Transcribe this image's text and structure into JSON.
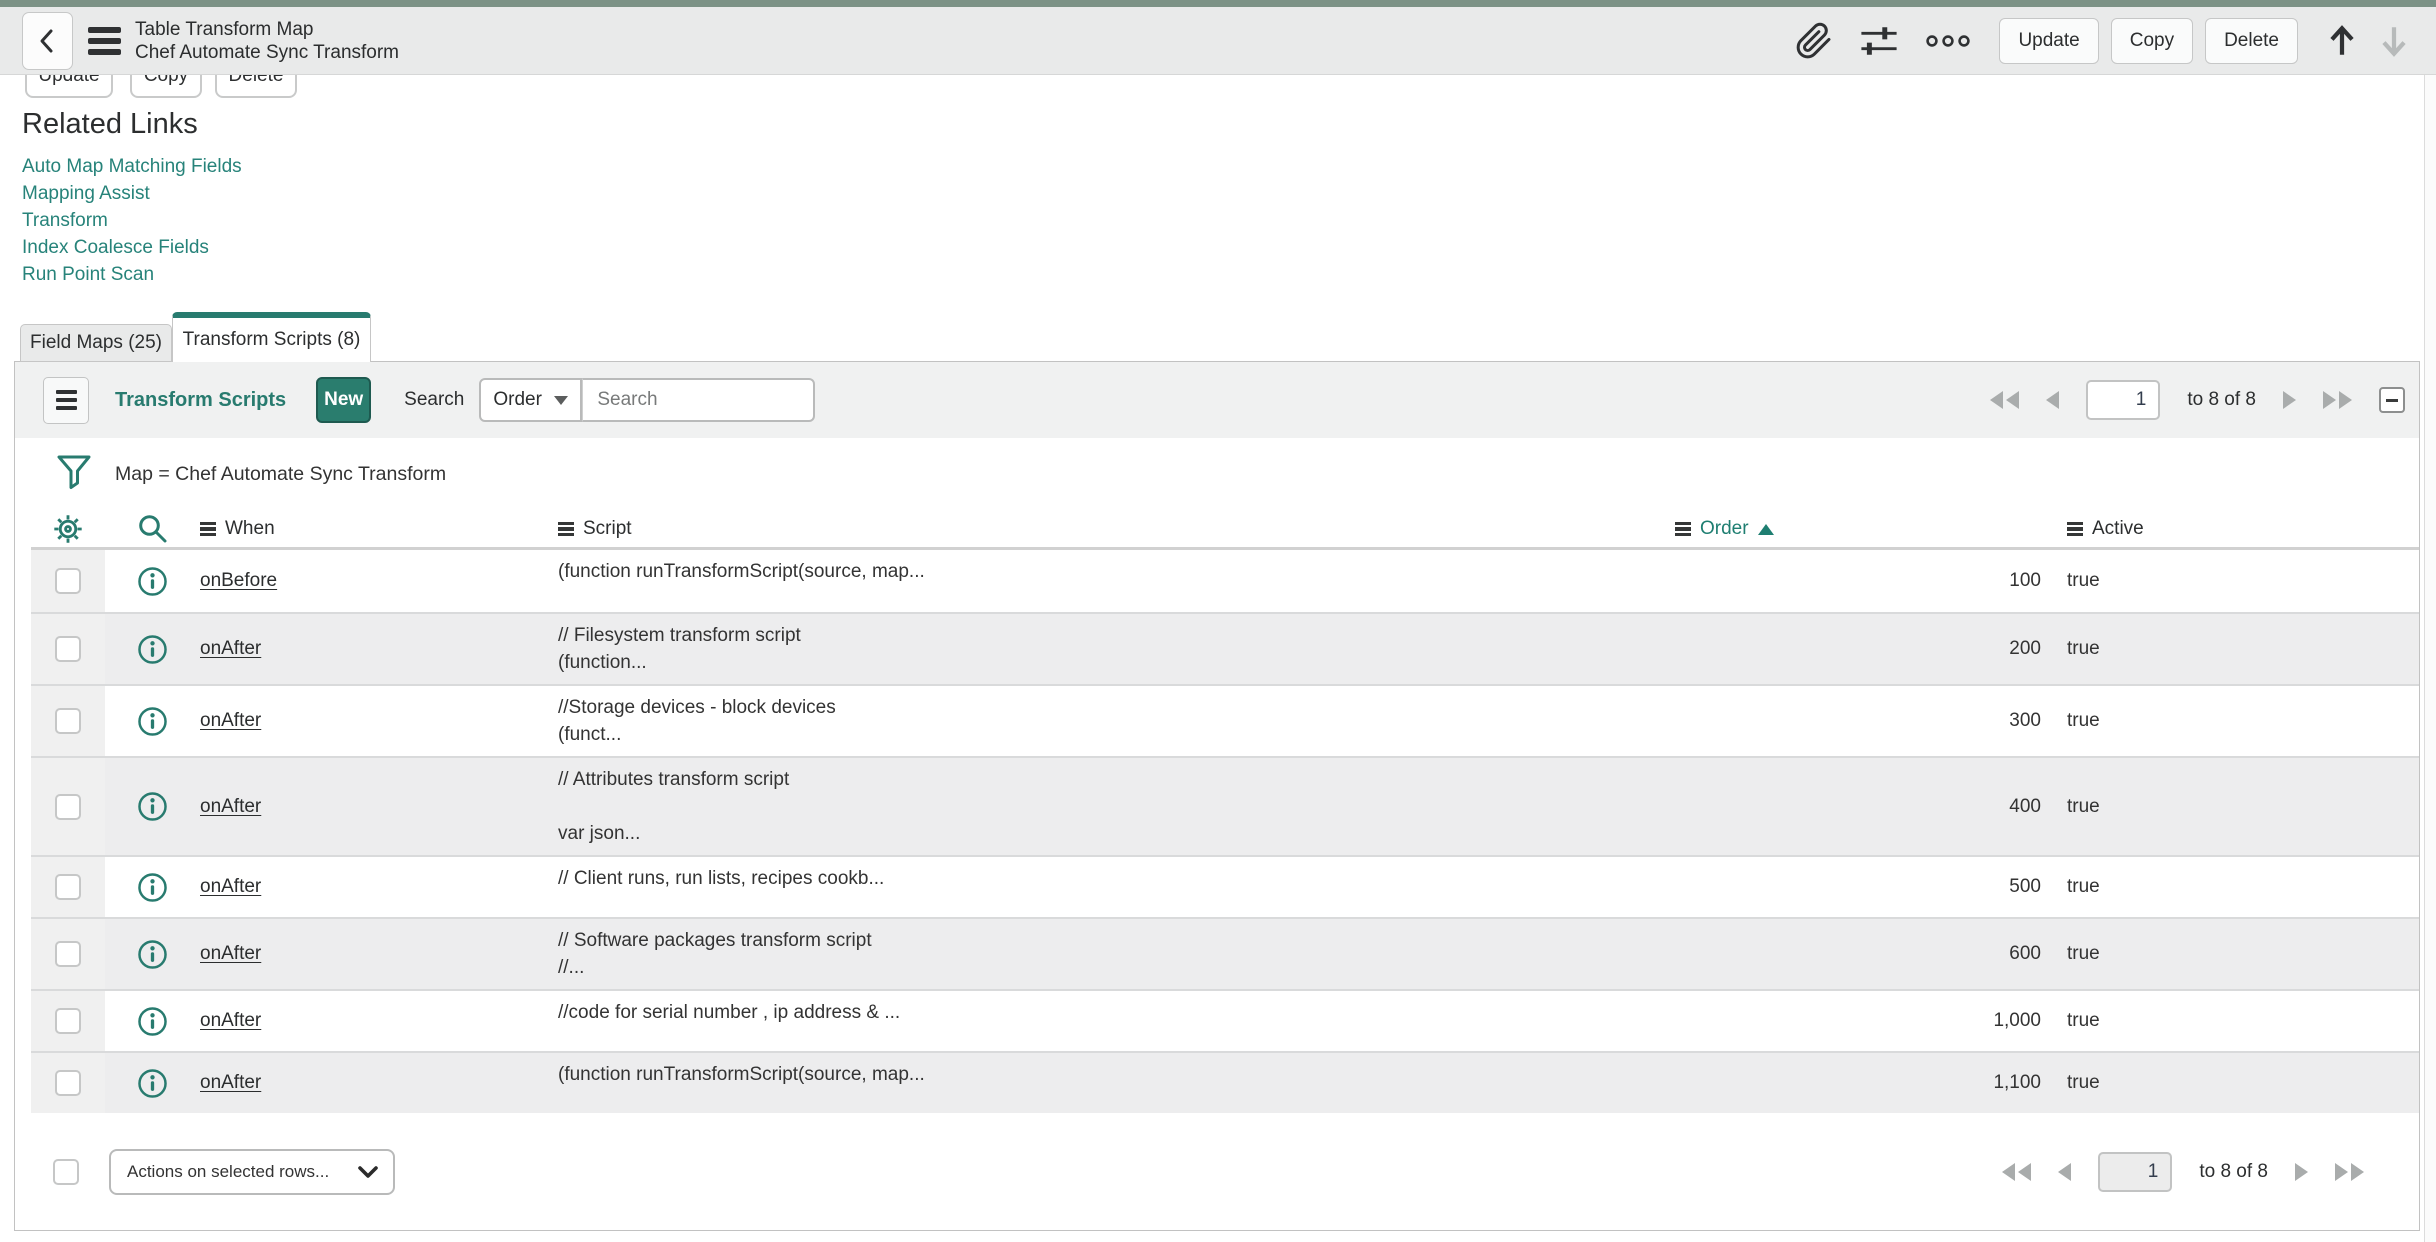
{
  "colors": {
    "accent": "#287b6f",
    "top_strip": "#7c9286",
    "header_bg": "#e9eaea",
    "row_alt": "#ededee",
    "link": "#27837a"
  },
  "icons": {
    "back": "chevron-left",
    "menu": "hamburger",
    "attachment": "paperclip",
    "personalize": "sliders",
    "more": "kebab-dots",
    "nav_up": "arrow-up",
    "nav_down": "arrow-down",
    "filter": "funnel",
    "list_personalize": "gear",
    "column_search": "magnifier",
    "row_info": "info-circle",
    "sort": "triangle-up",
    "collapse": "minus-box",
    "first": "double-triangle-left",
    "prev": "triangle-left",
    "next": "triangle-right",
    "last": "double-triangle-right",
    "actions": "chevron-down"
  },
  "header": {
    "title": "Table Transform Map",
    "subtitle": "Chef Automate Sync Transform",
    "buttons": [
      "Update",
      "Copy",
      "Delete"
    ]
  },
  "form_buttons": [
    "Update",
    "Copy",
    "Delete"
  ],
  "related": {
    "title": "Related Links",
    "links": [
      "Auto Map Matching Fields",
      "Mapping Assist",
      "Transform",
      "Index Coalesce Fields",
      "Run Point Scan"
    ]
  },
  "tabs": [
    {
      "label": "Field Maps (25)",
      "active": false
    },
    {
      "label": "Transform Scripts (8)",
      "active": true
    }
  ],
  "list": {
    "title": "Transform Scripts",
    "new_label": "New",
    "search_label": "Search",
    "search_by": "Order",
    "search_placeholder": "Search",
    "filter": "Map = Chef Automate Sync Transform",
    "columns": [
      "When",
      "Script",
      "Order",
      "Active"
    ],
    "sorted_column": "Order",
    "sort_direction": "ascending",
    "pagination": {
      "page": "1",
      "range": "to 8 of 8"
    },
    "rows": [
      {
        "when": "onBefore",
        "script_lines": [
          "(function runTransformScript(source, map..."
        ],
        "order": "100",
        "active": "true"
      },
      {
        "when": "onAfter",
        "script_lines": [
          "// Filesystem transform script",
          "(function..."
        ],
        "order": "200",
        "active": "true"
      },
      {
        "when": "onAfter",
        "script_lines": [
          "//Storage devices - block devices",
          "(funct..."
        ],
        "order": "300",
        "active": "true"
      },
      {
        "when": "onAfter",
        "script_lines": [
          "// Attributes transform script",
          "",
          "var json..."
        ],
        "order": "400",
        "active": "true"
      },
      {
        "when": "onAfter",
        "script_lines": [
          "// Client runs, run lists, recipes cookb..."
        ],
        "order": "500",
        "active": "true"
      },
      {
        "when": "onAfter",
        "script_lines": [
          "// Software packages transform script",
          "//..."
        ],
        "order": "600",
        "active": "true"
      },
      {
        "when": "onAfter",
        "script_lines": [
          "//code for serial number , ip address & ..."
        ],
        "order": "1,000",
        "active": "true"
      },
      {
        "when": "onAfter",
        "script_lines": [
          "(function runTransformScript(source, map..."
        ],
        "order": "1,100",
        "active": "true"
      }
    ],
    "footer": {
      "actions_label": "Actions on selected rows..."
    }
  }
}
